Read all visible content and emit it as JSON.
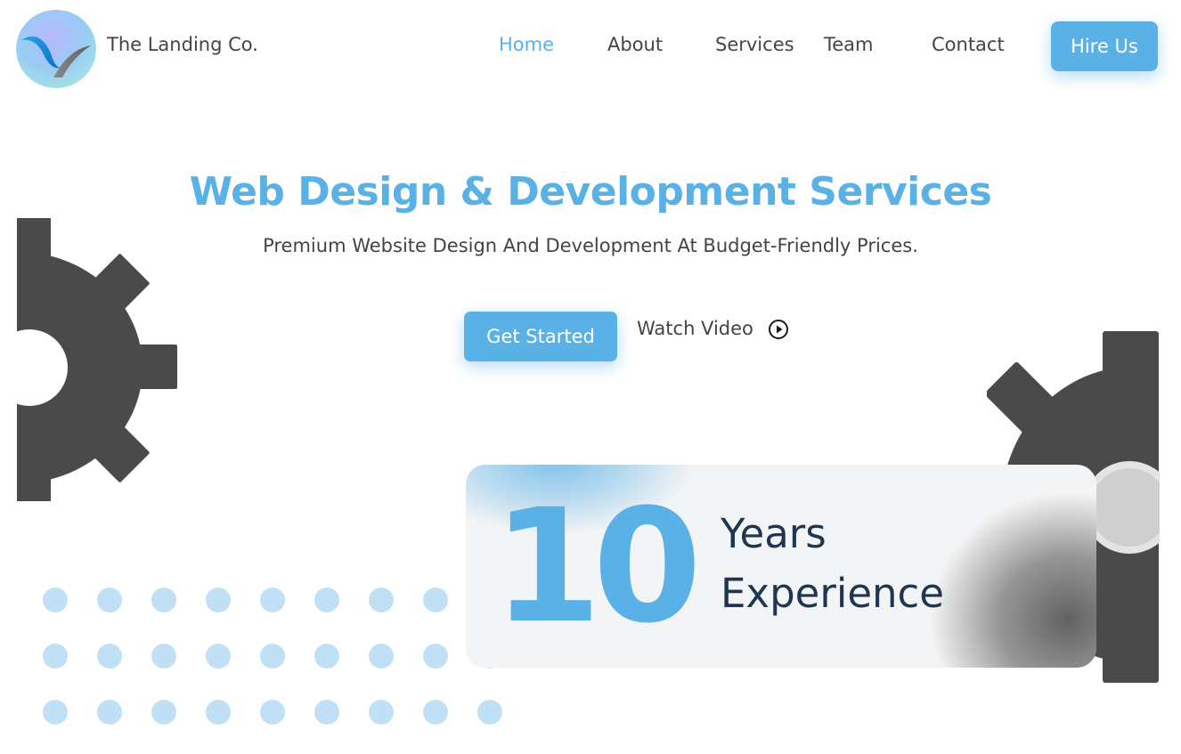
{
  "header": {
    "brand": "The Landing Co.",
    "nav": [
      {
        "label": "Home",
        "active": true
      },
      {
        "label": "About",
        "active": false
      },
      {
        "label": "Services",
        "active": false
      },
      {
        "label": "Team",
        "active": false
      },
      {
        "label": "Contact",
        "active": false
      }
    ],
    "cta_label": "Hire Us"
  },
  "hero": {
    "title": "Web Design & Development Services",
    "subtitle": "Premium Website Design And Development At Budget-Friendly Prices.",
    "primary_button": "Get Started",
    "secondary_link": "Watch Video"
  },
  "stats_card": {
    "number": "10",
    "line1": "Years",
    "line2": "Experience"
  },
  "icons": {
    "play": "play-circle-icon",
    "gear": "gear-icon",
    "logo": "v-swoosh-logo"
  },
  "colors": {
    "accent": "#5ab1e6",
    "text": "#444444",
    "gear": "#4a4a4a",
    "dots": "#bfe0f5",
    "card_text": "#1e3650"
  }
}
